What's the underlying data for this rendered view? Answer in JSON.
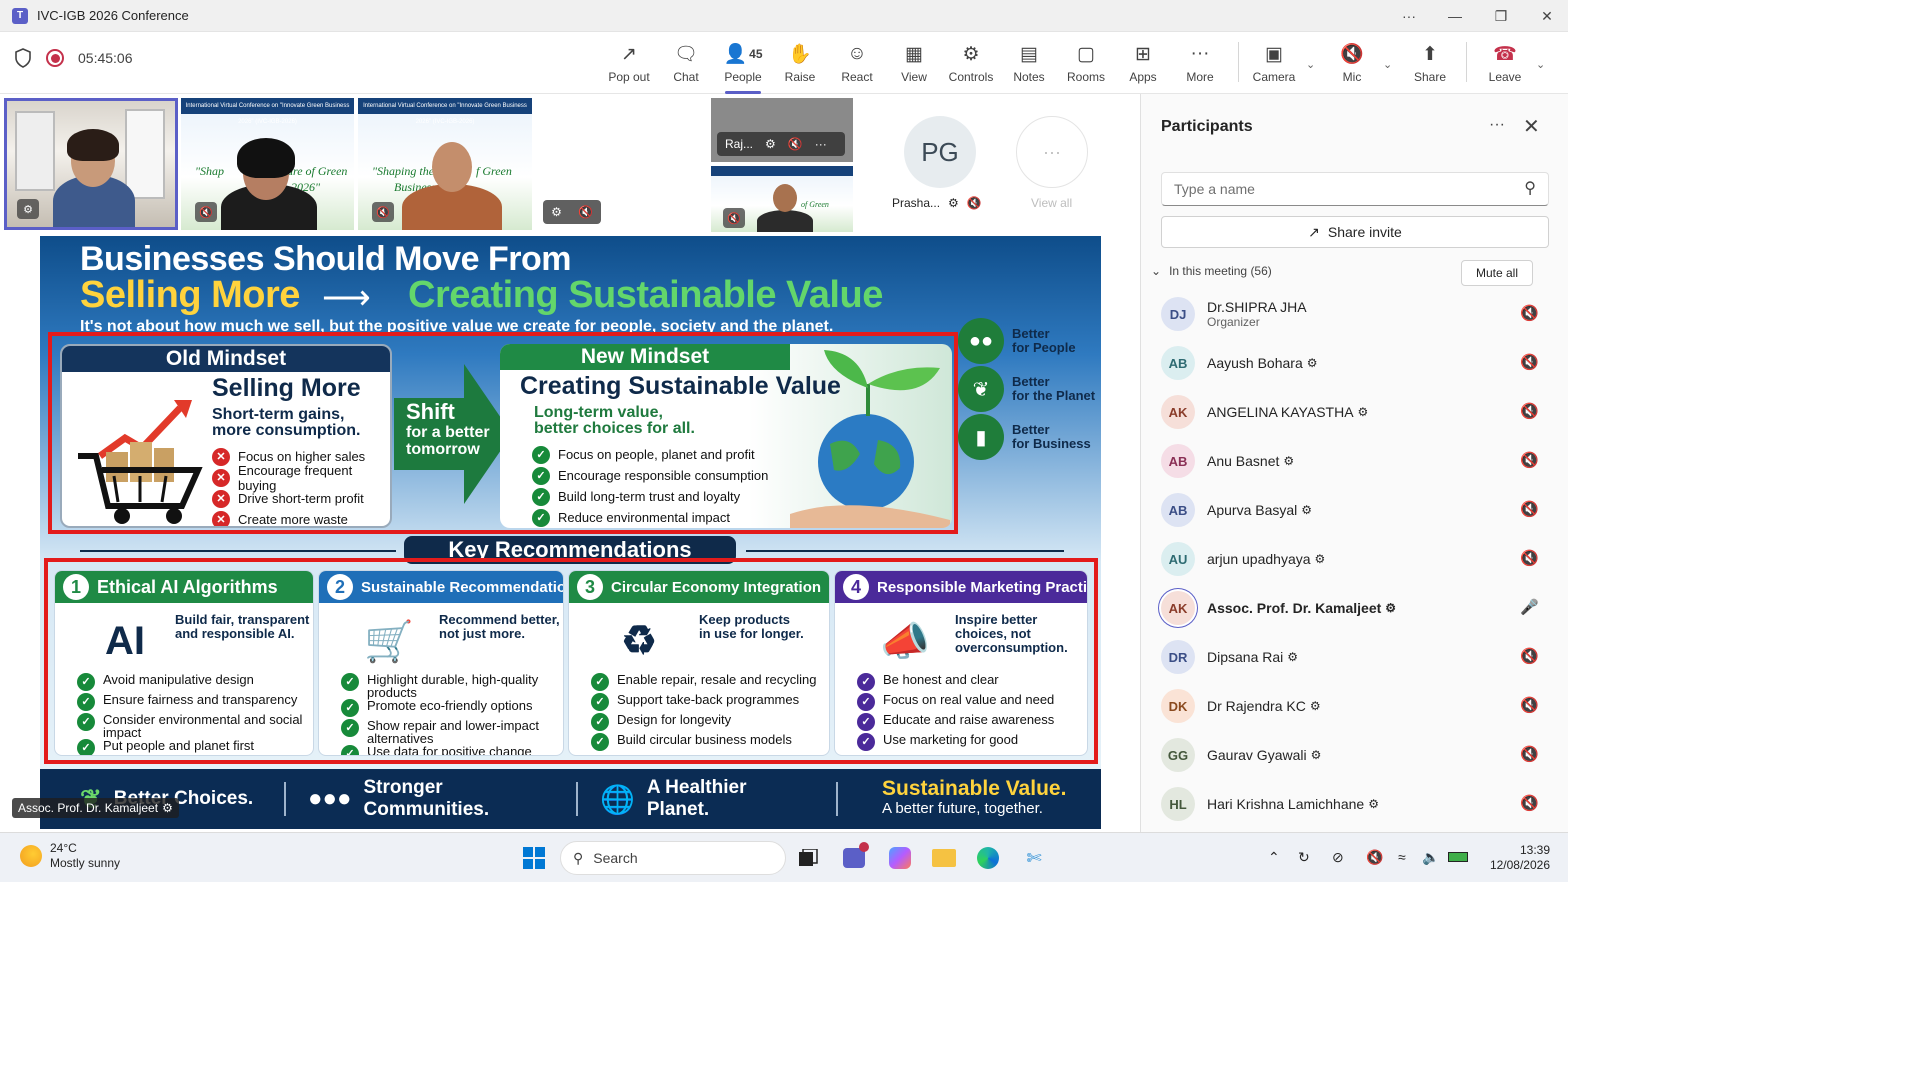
{
  "window": {
    "title": "IVC-IGB 2026 Conference"
  },
  "toolbar": {
    "timer": "05:45:06",
    "people_count": "45",
    "buttons": [
      {
        "label": "Pop out",
        "icon": "pop-out-icon"
      },
      {
        "label": "Chat",
        "icon": "chat-icon"
      },
      {
        "label": "People",
        "icon": "people-icon"
      },
      {
        "label": "Raise",
        "icon": "raise-hand-icon"
      },
      {
        "label": "React",
        "icon": "react-icon"
      },
      {
        "label": "View",
        "icon": "view-icon"
      },
      {
        "label": "Controls",
        "icon": "controls-icon"
      },
      {
        "label": "Notes",
        "icon": "notes-icon"
      },
      {
        "label": "Rooms",
        "icon": "rooms-icon"
      },
      {
        "label": "Apps",
        "icon": "apps-icon"
      },
      {
        "label": "More",
        "icon": "more-icon"
      },
      {
        "label": "Camera",
        "icon": "camera-off-icon"
      },
      {
        "label": "Mic",
        "icon": "mic-off-icon"
      },
      {
        "label": "Share",
        "icon": "share-icon"
      },
      {
        "label": "Leave",
        "icon": "leave-icon"
      }
    ]
  },
  "gallery": {
    "small_tile_name": "Raj...",
    "pg_initials": "PG",
    "pg_name": "Prasha...",
    "view_all": "View all"
  },
  "slide": {
    "title_line1": "Businesses Should Move From",
    "title_left": "Selling More",
    "title_right": "Creating Sustainable Value",
    "subtitle": "It's not about how much we sell, but the positive value we create for people, society and the planet.",
    "old": {
      "header": "Old Mindset",
      "big": "Selling More",
      "sub1": "Short-term gains,",
      "sub2": "more consumption.",
      "items": [
        "Focus on higher sales",
        "Encourage frequent buying",
        "Drive short-term profit",
        "Create more waste"
      ]
    },
    "shift": {
      "l1": "Shift",
      "l2": "for a better",
      "l3": "tomorrow"
    },
    "new": {
      "header": "New Mindset",
      "big": "Creating Sustainable Value",
      "sub1": "Long-term value,",
      "sub2": "better choices for all.",
      "items": [
        "Focus on people, planet and profit",
        "Encourage responsible consumption",
        "Build long-term trust and loyalty",
        "Reduce environmental impact"
      ]
    },
    "benefits": [
      "Better\nfor People",
      "Better\nfor the Planet",
      "Better\nfor Business"
    ],
    "key_recommendations": "Key Recommendations",
    "recs": [
      {
        "num": "1",
        "title": "Ethical AI Algorithms",
        "tag": "Build fair, transparent\nand responsible AI.",
        "items": [
          "Avoid manipulative design",
          "Ensure fairness and transparency",
          "Consider environmental and social impact",
          "Put people and planet first"
        ]
      },
      {
        "num": "2",
        "title": "Sustainable Recommendations",
        "tag": "Recommend better,\nnot just more.",
        "items": [
          "Highlight durable, high-quality products",
          "Promote eco-friendly options",
          "Show repair and lower-impact alternatives",
          "Use data for positive change"
        ]
      },
      {
        "num": "3",
        "title": "Circular Economy Integration",
        "tag": "Keep products\nin use for longer.",
        "items": [
          "Enable repair, resale and recycling",
          "Support take-back programmes",
          "Design for longevity",
          "Build circular business models"
        ]
      },
      {
        "num": "4",
        "title": "Responsible Marketing Practices",
        "tag": "Inspire better\nchoices, not\noverconsumption.",
        "items": [
          "Be honest and clear",
          "Focus on real value and need",
          "Educate and raise awareness",
          "Use marketing for good"
        ]
      }
    ],
    "footer": [
      "Better Choices.",
      "Stronger Communities.",
      "A Healthier Planet."
    ],
    "footer_end1": "Sustainable Value.",
    "footer_end2": "A better future, together."
  },
  "speaker_label": "Assoc. Prof. Dr. Kamaljeet",
  "participants_panel": {
    "title": "Participants",
    "search_placeholder": "Type a name",
    "share_invite": "Share invite",
    "in_meeting": "In this meeting (56)",
    "mute_all": "Mute all",
    "people": [
      {
        "initials": "DJ",
        "name": "Dr.SHIPRA JHA",
        "role": "Organizer",
        "bg": "#dde3f3",
        "fg": "#3b4e86"
      },
      {
        "initials": "AB",
        "name": "Aayush Bohara",
        "role": "",
        "bg": "#dbeef0",
        "fg": "#2e6b72"
      },
      {
        "initials": "AK",
        "name": "ANGELINA KAYASTHA",
        "role": "",
        "bg": "#f6dfd9",
        "fg": "#8a3c2a"
      },
      {
        "initials": "AB",
        "name": "Anu Basnet",
        "role": "",
        "bg": "#f5dde6",
        "fg": "#8a2f55"
      },
      {
        "initials": "AB",
        "name": "Apurva Basyal",
        "role": "",
        "bg": "#dde3f3",
        "fg": "#3b4e86"
      },
      {
        "initials": "AU",
        "name": "arjun upadhyaya",
        "role": "",
        "bg": "#dbeef0",
        "fg": "#2e6b72"
      },
      {
        "initials": "AK",
        "name": "Assoc. Prof. Dr. Kamaljeet",
        "role": "",
        "bg": "#f6dfd9",
        "fg": "#8a3c2a"
      },
      {
        "initials": "DR",
        "name": "Dipsana Rai",
        "role": "",
        "bg": "#dde3f3",
        "fg": "#3b4e86"
      },
      {
        "initials": "DK",
        "name": "Dr Rajendra KC",
        "role": "",
        "bg": "#fae3d6",
        "fg": "#8a4a1f"
      },
      {
        "initials": "GG",
        "name": "Gaurav Gyawali",
        "role": "",
        "bg": "#e3e8df",
        "fg": "#44573b"
      },
      {
        "initials": "HL",
        "name": "Hari Krishna Lamichhane",
        "role": "",
        "bg": "#e3e8df",
        "fg": "#44573b"
      }
    ]
  },
  "taskbar": {
    "temp": "24°C",
    "weather": "Mostly sunny",
    "search": "Search",
    "time": "13:39",
    "date": "12/08/2026"
  }
}
